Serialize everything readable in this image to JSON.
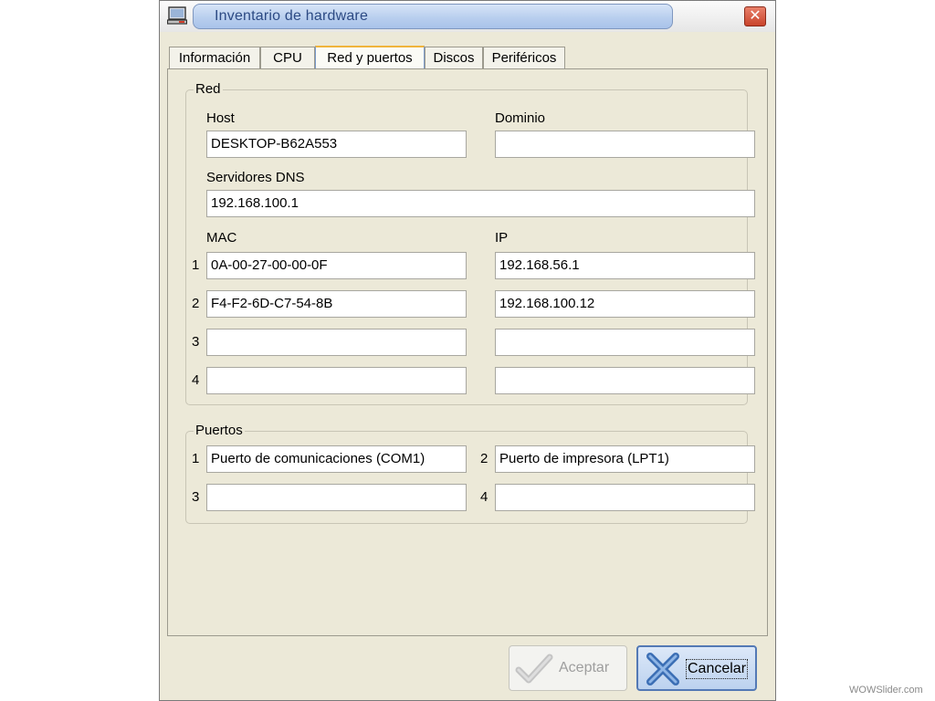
{
  "window": {
    "title": "Inventario de hardware",
    "close_glyph": "✕"
  },
  "tabs": [
    {
      "label": "Información"
    },
    {
      "label": "CPU"
    },
    {
      "label": "Red y puertos"
    },
    {
      "label": "Discos"
    },
    {
      "label": "Periféricos"
    }
  ],
  "active_tab": "Red y puertos",
  "red": {
    "group_label": "Red",
    "host_label": "Host",
    "host_value": "DESKTOP-B62A553",
    "domain_label": "Dominio",
    "domain_value": "",
    "dns_label": "Servidores DNS",
    "dns_value": "192.168.100.1",
    "mac_label": "MAC",
    "ip_label": "IP",
    "rows": [
      {
        "num": "1",
        "mac": "0A-00-27-00-00-0F",
        "ip": "192.168.56.1"
      },
      {
        "num": "2",
        "mac": "F4-F2-6D-C7-54-8B",
        "ip": "192.168.100.12"
      },
      {
        "num": "3",
        "mac": "",
        "ip": ""
      },
      {
        "num": "4",
        "mac": "",
        "ip": ""
      }
    ]
  },
  "puertos": {
    "group_label": "Puertos",
    "ports": [
      {
        "num": "1",
        "value": "Puerto de comunicaciones (COM1)"
      },
      {
        "num": "2",
        "value": "Puerto de impresora (LPT1)"
      },
      {
        "num": "3",
        "value": ""
      },
      {
        "num": "4",
        "value": ""
      }
    ]
  },
  "buttons": {
    "accept_label": "Aceptar",
    "accept_enabled": false,
    "cancel_label": "Cancelar"
  },
  "icons": {
    "app": "computer-icon",
    "accept": "checkmark-icon",
    "cancel": "x-mark-icon"
  },
  "colors": {
    "window_bg": "#ece9d8",
    "title_accent": "#2c4a84",
    "close_button": "#c9432b",
    "cancel_border": "#5379b5"
  },
  "watermark": "WOWSlider.com"
}
